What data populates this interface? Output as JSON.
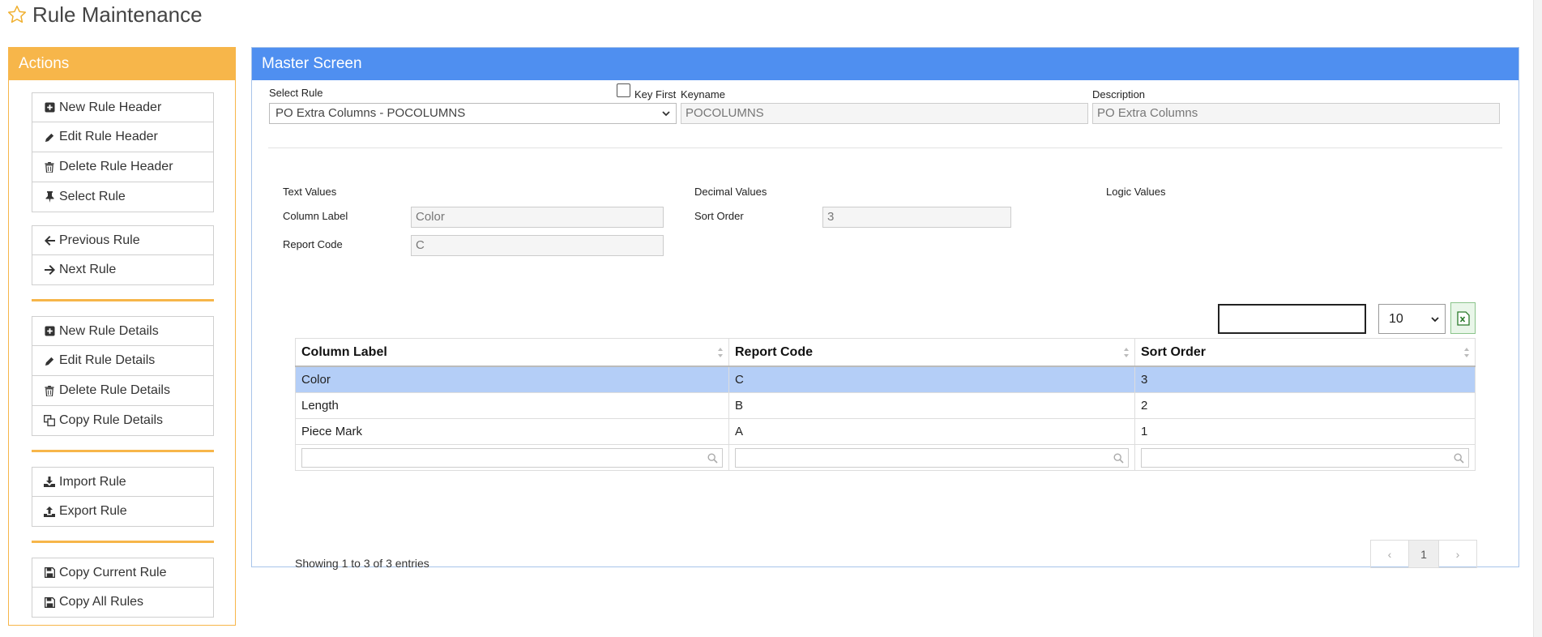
{
  "page": {
    "title": "Rule Maintenance"
  },
  "actions": {
    "heading": "Actions",
    "group1": [
      "New Rule Header",
      "Edit Rule Header",
      "Delete Rule Header",
      "Select Rule"
    ],
    "group2": [
      "Previous Rule",
      "Next Rule"
    ],
    "group3": [
      "New Rule Details",
      "Edit Rule Details",
      "Delete Rule Details",
      "Copy Rule Details"
    ],
    "group4": [
      "Import Rule",
      "Export Rule"
    ],
    "group5": [
      "Copy Current Rule",
      "Copy All Rules"
    ]
  },
  "master": {
    "heading": "Master Screen",
    "select_rule_label": "Select Rule",
    "select_rule_value": "PO Extra Columns - POCOLUMNS",
    "key_first_label": "Key First",
    "keyname_label": "Keyname",
    "keyname_value": "POCOLUMNS",
    "description_label": "Description",
    "description_value": "PO Extra Columns",
    "text_values_label": "Text Values",
    "decimal_values_label": "Decimal Values",
    "logic_values_label": "Logic Values",
    "column_label_label": "Column Label",
    "column_label_value": "Color",
    "report_code_label": "Report Code",
    "report_code_value": "C",
    "sort_order_label": "Sort Order",
    "sort_order_value": "3"
  },
  "table": {
    "page_length": "10",
    "columns": [
      "Column Label",
      "Report Code",
      "Sort Order"
    ],
    "rows": [
      [
        "Color",
        "C",
        "3"
      ],
      [
        "Length",
        "B",
        "2"
      ],
      [
        "Piece Mark",
        "A",
        "1"
      ]
    ],
    "info": "Showing 1 to 3 of 3 entries",
    "pager": {
      "prev": "‹",
      "current": "1",
      "next": "›"
    }
  }
}
